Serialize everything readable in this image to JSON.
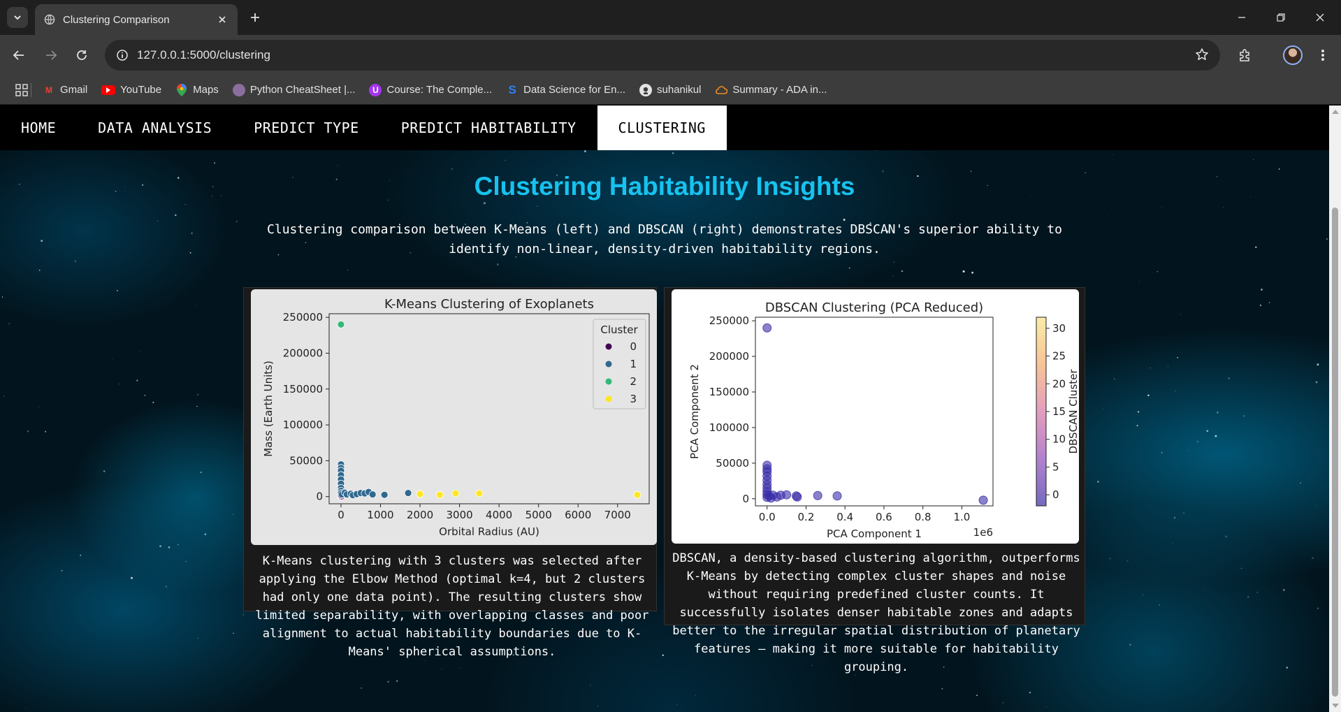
{
  "browser": {
    "tab_title": "Clustering Comparison",
    "url": "127.0.0.1:5000/clustering",
    "bookmarks": [
      "Gmail",
      "YouTube",
      "Maps",
      "Python CheatSheet |...",
      "Course: The Comple...",
      "Data Science for En...",
      "suhanikul",
      "Summary - ADA in..."
    ]
  },
  "nav": {
    "home": "HOME",
    "data_analysis": "DATA ANALYSIS",
    "predict_type": "PREDICT TYPE",
    "predict_habitability": "PREDICT HABITABILITY",
    "clustering": "CLUSTERING"
  },
  "page": {
    "title": "Clustering Habitability Insights",
    "intro": "Clustering comparison between K-Means (left) and DBSCAN (right) demonstrates DBSCAN's superior ability to identify non-linear, density-driven habitability regions."
  },
  "kmeans": {
    "description": "K-Means clustering with 3 clusters was selected after applying the Elbow Method (optimal k=4, but 2 clusters had only one data point). The resulting clusters show limited separability, with overlapping classes and poor alignment to actual habitability boundaries due to K-Means' spherical assumptions."
  },
  "dbscan": {
    "description": "DBSCAN, a density-based clustering algorithm, outperforms K-Means by detecting complex cluster shapes and noise without requiring predefined cluster counts. It successfully isolates denser habitable zones and adapts better to the irregular spatial distribution of planetary features — making it more suitable for habitability grouping."
  },
  "chart_data": [
    {
      "type": "scatter",
      "title": "K-Means Clustering of Exoplanets",
      "xlabel": "Orbital Radius (AU)",
      "ylabel": "Mass (Earth Units)",
      "xlim": [
        -300,
        7800
      ],
      "ylim": [
        -10000,
        255000
      ],
      "xticks": [
        0,
        1000,
        2000,
        3000,
        4000,
        5000,
        6000,
        7000
      ],
      "yticks": [
        0,
        50000,
        100000,
        150000,
        200000,
        250000
      ],
      "legend_title": "Cluster",
      "legend_position": "top-right",
      "background": "#e5e5e5",
      "series": [
        {
          "name": "0",
          "color": "#440154",
          "points": [
            [
              0,
              200
            ],
            [
              5,
              1200
            ],
            [
              10,
              400
            ],
            [
              2,
              2000
            ]
          ]
        },
        {
          "name": "1",
          "color": "#31688e",
          "points": [
            [
              0,
              45000
            ],
            [
              0,
              40000
            ],
            [
              0,
              36000
            ],
            [
              0,
              30000
            ],
            [
              0,
              24000
            ],
            [
              0,
              18000
            ],
            [
              0,
              12000
            ],
            [
              0,
              8000
            ],
            [
              0,
              5000
            ],
            [
              20,
              3000
            ],
            [
              100,
              5500
            ],
            [
              150,
              3000
            ],
            [
              250,
              4000
            ],
            [
              300,
              2000
            ],
            [
              400,
              3500
            ],
            [
              500,
              5000
            ],
            [
              600,
              4500
            ],
            [
              700,
              6500
            ],
            [
              800,
              3000
            ],
            [
              1100,
              2500
            ],
            [
              1700,
              5000
            ]
          ]
        },
        {
          "name": "2",
          "color": "#35b779",
          "points": [
            [
              0,
              240000
            ]
          ]
        },
        {
          "name": "3",
          "color": "#fde725",
          "points": [
            [
              2000,
              3500
            ],
            [
              2500,
              2500
            ],
            [
              2900,
              4500
            ],
            [
              3500,
              4500
            ],
            [
              7500,
              2500
            ]
          ]
        }
      ]
    },
    {
      "type": "scatter",
      "title": "DBSCAN Clustering (PCA Reduced)",
      "xlabel": "PCA Component 1",
      "ylabel": "PCA Component 2",
      "x_offset_label": "1e6",
      "xlim": [
        -60000,
        1160000
      ],
      "ylim": [
        -10000,
        255000
      ],
      "xticks": [
        0.0,
        0.2,
        0.4,
        0.6,
        0.8,
        1.0
      ],
      "yticks": [
        0,
        50000,
        100000,
        150000,
        200000,
        250000
      ],
      "colorbar_label": "DBSCAN Cluster",
      "colorbar_ticks": [
        0,
        5,
        10,
        15,
        20,
        25,
        30
      ],
      "colorbar_range": [
        -2,
        32
      ],
      "point_color": "#3a2fa8",
      "points": [
        [
          0,
          240000
        ],
        [
          0,
          47000
        ],
        [
          0,
          42000
        ],
        [
          0,
          38000
        ],
        [
          0,
          32000
        ],
        [
          0,
          26000
        ],
        [
          0,
          20000
        ],
        [
          0,
          15000
        ],
        [
          0,
          10000
        ],
        [
          0,
          6000
        ],
        [
          0,
          2000
        ],
        [
          10000,
          4000
        ],
        [
          20000,
          1000
        ],
        [
          30000,
          5000
        ],
        [
          50000,
          2500
        ],
        [
          70000,
          5000
        ],
        [
          100000,
          5500
        ],
        [
          150000,
          4000
        ],
        [
          155000,
          2500
        ],
        [
          260000,
          4500
        ],
        [
          360000,
          4000
        ],
        [
          1110000,
          -2000
        ]
      ]
    }
  ]
}
